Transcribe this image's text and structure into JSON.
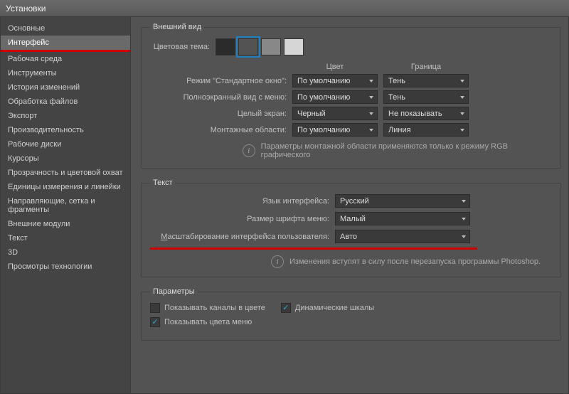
{
  "window": {
    "title": "Установки"
  },
  "sidebar": {
    "items": [
      {
        "label": "Основные"
      },
      {
        "label": "Интерфейс",
        "selected": true
      },
      {
        "label": "Рабочая среда"
      },
      {
        "label": "Инструменты"
      },
      {
        "label": "История изменений"
      },
      {
        "label": "Обработка файлов"
      },
      {
        "label": "Экспорт"
      },
      {
        "label": "Производительность"
      },
      {
        "label": "Рабочие диски"
      },
      {
        "label": "Курсоры"
      },
      {
        "label": "Прозрачность и цветовой охват"
      },
      {
        "label": "Единицы измерения и линейки"
      },
      {
        "label": "Направляющие, сетка и фрагменты"
      },
      {
        "label": "Внешние модули"
      },
      {
        "label": "Текст"
      },
      {
        "label": "3D"
      },
      {
        "label": "Просмотры технологии"
      }
    ]
  },
  "appearance": {
    "legend": "Внешний вид",
    "color_theme_label": "Цветовая тема:",
    "swatches": [
      "#2b2b2b",
      "#535353",
      "#888888",
      "#d6d6d6"
    ],
    "selected_swatch_index": 1,
    "headers": {
      "color": "Цвет",
      "border": "Граница"
    },
    "modes": [
      {
        "label": "Режим \"Стандартное окно\":",
        "color": "По умолчанию",
        "border": "Тень"
      },
      {
        "label": "Полноэкранный вид с меню:",
        "color": "По умолчанию",
        "border": "Тень"
      },
      {
        "label": "Целый экран:",
        "color": "Черный",
        "border": "Не показывать"
      },
      {
        "label": "Монтажные области:",
        "color": "По умолчанию",
        "border": "Линия"
      }
    ],
    "info": "Параметры монтажной области применяются только к режиму RGB графического"
  },
  "text": {
    "legend": "Текст",
    "lang_label": "Язык интерфейса:",
    "lang_value": "Русский",
    "font_label": "Размер шрифта меню:",
    "font_value": "Малый",
    "scale_label": "Масштабирование интерфейса пользователя:",
    "scale_value": "Авто",
    "info": "Изменения вступят в силу после перезапуска программы Photoshop."
  },
  "params": {
    "legend": "Параметры",
    "show_channels": {
      "label": "Показывать каналы в цвете",
      "checked": false
    },
    "dynamic_scales": {
      "label": "Динамические шкалы",
      "checked": true
    },
    "show_menu_colors": {
      "label": "Показывать цвета меню",
      "checked": true
    }
  }
}
